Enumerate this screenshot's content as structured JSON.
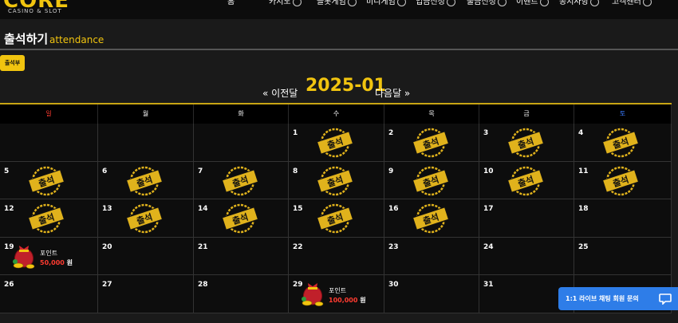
{
  "header": {
    "logo": "CORE",
    "logo_sub": "CASINO & SLOT",
    "nav": [
      "홈",
      "카지노",
      "슬롯게임",
      "미니게임",
      "입금신청",
      "출금신청",
      "이벤트",
      "공지사항",
      "고객센터"
    ]
  },
  "section": {
    "title": "출석하기",
    "subtitle": "attendance",
    "attendance_button": "출석부"
  },
  "month_nav": {
    "prev": "« 이전달",
    "month": "2025-01",
    "next": "다음달 »"
  },
  "calendar": {
    "weekdays": [
      "일",
      "월",
      "화",
      "수",
      "목",
      "금",
      "토"
    ],
    "weekday_colors": [
      "#ff3b30",
      "#ffffff",
      "#ffffff",
      "#ffffff",
      "#ffffff",
      "#ffffff",
      "#3a7bff"
    ],
    "stamp_text": "출석",
    "point_label": "포인트",
    "point_unit": "원",
    "cells": [
      {
        "day": ""
      },
      {
        "day": ""
      },
      {
        "day": ""
      },
      {
        "day": "1",
        "stamp": true
      },
      {
        "day": "2",
        "stamp": true
      },
      {
        "day": "3",
        "stamp": true
      },
      {
        "day": "4",
        "stamp": true
      },
      {
        "day": "5",
        "stamp": true
      },
      {
        "day": "6",
        "stamp": true
      },
      {
        "day": "7",
        "stamp": true
      },
      {
        "day": "8",
        "stamp": true
      },
      {
        "day": "9",
        "stamp": true
      },
      {
        "day": "10",
        "stamp": true
      },
      {
        "day": "11",
        "stamp": true
      },
      {
        "day": "12",
        "stamp": true
      },
      {
        "day": "13",
        "stamp": true
      },
      {
        "day": "14",
        "stamp": true
      },
      {
        "day": "15",
        "stamp": true
      },
      {
        "day": "16",
        "stamp": true
      },
      {
        "day": "17"
      },
      {
        "day": "18"
      },
      {
        "day": "19",
        "point": "50,000"
      },
      {
        "day": "20"
      },
      {
        "day": "21"
      },
      {
        "day": "22"
      },
      {
        "day": "23"
      },
      {
        "day": "24"
      },
      {
        "day": "25"
      },
      {
        "day": "26"
      },
      {
        "day": "27"
      },
      {
        "day": "28"
      },
      {
        "day": "29",
        "point": "100,000"
      },
      {
        "day": "30"
      },
      {
        "day": "31"
      },
      {
        "day": ""
      }
    ]
  },
  "chat": {
    "label": "1:1 라이브 채팅 회원 문의"
  },
  "colors": {
    "accent": "#f1c40f",
    "stamp_gold": "#e0b21c",
    "chat_blue": "#2e7de8",
    "point_red": "#ff3b30"
  }
}
